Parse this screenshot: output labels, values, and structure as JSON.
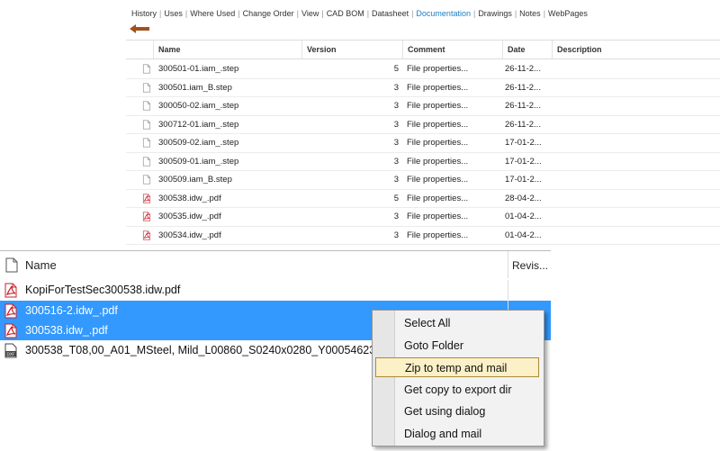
{
  "tabs": [
    {
      "label": "History",
      "active": false
    },
    {
      "label": "Uses",
      "active": false
    },
    {
      "label": "Where Used",
      "active": false
    },
    {
      "label": "Change Order",
      "active": false
    },
    {
      "label": "View",
      "active": false
    },
    {
      "label": "CAD BOM",
      "active": false
    },
    {
      "label": "Datasheet",
      "active": false
    },
    {
      "label": "Documentation",
      "active": true
    },
    {
      "label": "Drawings",
      "active": false
    },
    {
      "label": "Notes",
      "active": false
    },
    {
      "label": "WebPages",
      "active": false
    }
  ],
  "grid": {
    "headers": {
      "name": "Name",
      "version": "Version",
      "comment": "Comment",
      "date": "Date",
      "description": "Description"
    },
    "rows": [
      {
        "icon": "file-icon",
        "name": "300501-01.iam_.step",
        "version": "5",
        "comment": "File properties...",
        "date": "26-11-2..."
      },
      {
        "icon": "file-icon",
        "name": "300501.iam_B.step",
        "version": "3",
        "comment": "File properties...",
        "date": "26-11-2..."
      },
      {
        "icon": "file-icon",
        "name": "300050-02.iam_.step",
        "version": "3",
        "comment": "File properties...",
        "date": "26-11-2..."
      },
      {
        "icon": "file-icon",
        "name": "300712-01.iam_.step",
        "version": "3",
        "comment": "File properties...",
        "date": "26-11-2..."
      },
      {
        "icon": "file-icon",
        "name": "300509-02.iam_.step",
        "version": "3",
        "comment": "File properties...",
        "date": "17-01-2..."
      },
      {
        "icon": "file-icon",
        "name": "300509-01.iam_.step",
        "version": "3",
        "comment": "File properties...",
        "date": "17-01-2..."
      },
      {
        "icon": "file-icon",
        "name": "300509.iam_B.step",
        "version": "3",
        "comment": "File properties...",
        "date": "17-01-2..."
      },
      {
        "icon": "pdf-icon",
        "name": "300538.idw_.pdf",
        "version": "5",
        "comment": "File properties...",
        "date": "28-04-2..."
      },
      {
        "icon": "pdf-icon",
        "name": "300535.idw_.pdf",
        "version": "3",
        "comment": "File properties...",
        "date": "01-04-2..."
      },
      {
        "icon": "pdf-icon",
        "name": "300534.idw_.pdf",
        "version": "3",
        "comment": "File properties...",
        "date": "01-04-2..."
      }
    ]
  },
  "list": {
    "headers": {
      "name": "Name",
      "revision": "Revis..."
    },
    "rows": [
      {
        "icon": "pdf-icon",
        "name": "KopiForTestSec300538.idw.pdf",
        "selected": false
      },
      {
        "icon": "pdf-icon",
        "name": "300516-2.idw_.pdf",
        "selected": true
      },
      {
        "icon": "pdf-icon",
        "name": "300538.idw_.pdf",
        "selected": true
      },
      {
        "icon": "dxf-icon",
        "name": "300538_T08,00_A01_MSteel, Mild_L00860_S0240x0280_Y00054623_R",
        "selected": false
      }
    ]
  },
  "context_menu": {
    "items": [
      {
        "label": "Select All",
        "highlighted": false
      },
      {
        "label": "Goto Folder",
        "highlighted": false
      },
      {
        "label": "Zip to temp and mail",
        "highlighted": true
      },
      {
        "label": "Get copy to export dir",
        "highlighted": false
      },
      {
        "label": "Get using dialog",
        "highlighted": false
      },
      {
        "label": "Dialog and mail",
        "highlighted": false
      }
    ]
  },
  "colors": {
    "accent": "#1a7fc4",
    "selection": "#3399ff",
    "menu_highlight": "#fcf0c8",
    "back_arrow": "#a0521c"
  }
}
